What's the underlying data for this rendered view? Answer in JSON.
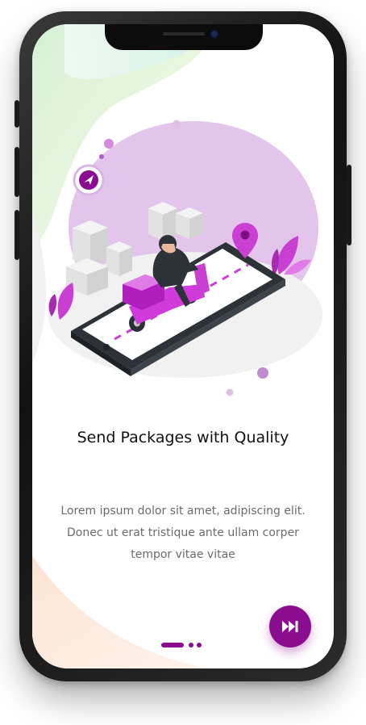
{
  "onboarding": {
    "title": "Send Packages with Quality",
    "description": "Lorem ipsum dolor sit amet, adipiscing elit. Donec ut erat tristique ante ullam corper tempor vitae vitae",
    "page_indicator": {
      "total": 3,
      "active": 1
    },
    "next_button": {
      "icon": "skip-forward-icon"
    }
  },
  "colors": {
    "accent": "#8b0d8f",
    "accent_light": "#b05bd0",
    "blob": "#e3c4ea",
    "title_text": "#111111",
    "body_text": "#6b6b6b"
  }
}
